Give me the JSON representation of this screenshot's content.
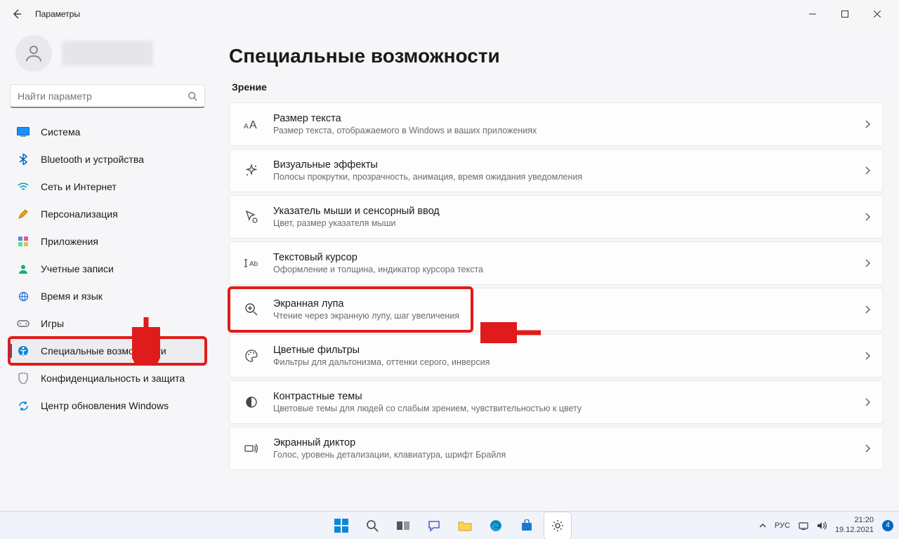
{
  "window": {
    "app_title": "Параметры"
  },
  "search": {
    "placeholder": "Найти параметр"
  },
  "nav": {
    "items": [
      {
        "label": "Система"
      },
      {
        "label": "Bluetooth и устройства"
      },
      {
        "label": "Сеть и Интернет"
      },
      {
        "label": "Персонализация"
      },
      {
        "label": "Приложения"
      },
      {
        "label": "Учетные записи"
      },
      {
        "label": "Время и язык"
      },
      {
        "label": "Игры"
      },
      {
        "label": "Специальные возможности"
      },
      {
        "label": "Конфиденциальность и защита"
      },
      {
        "label": "Центр обновления Windows"
      }
    ]
  },
  "page": {
    "title": "Специальные возможности",
    "section_vision": "Зрение"
  },
  "cards": [
    {
      "title": "Размер текста",
      "desc": "Размер текста, отображаемого в Windows и ваших приложениях"
    },
    {
      "title": "Визуальные эффекты",
      "desc": "Полосы прокрутки, прозрачность, анимация, время ожидания уведомления"
    },
    {
      "title": "Указатель мыши и сенсорный ввод",
      "desc": "Цвет, размер указателя мыши"
    },
    {
      "title": "Текстовый курсор",
      "desc": "Оформление и толщина, индикатор курсора текста"
    },
    {
      "title": "Экранная лупа",
      "desc": "Чтение через экранную лупу, шаг увеличения"
    },
    {
      "title": "Цветные фильтры",
      "desc": "Фильтры для дальтонизма, оттенки серого, инверсия"
    },
    {
      "title": "Контрастные темы",
      "desc": "Цветовые темы для людей со слабым зрением, чувствительностью к цвету"
    },
    {
      "title": "Экранный диктор",
      "desc": "Голос, уровень детализации, клавиатура, шрифт Брайля"
    }
  ],
  "tray": {
    "lang": "РУС",
    "time": "21:20",
    "date": "19.12.2021",
    "notif_count": "4"
  }
}
